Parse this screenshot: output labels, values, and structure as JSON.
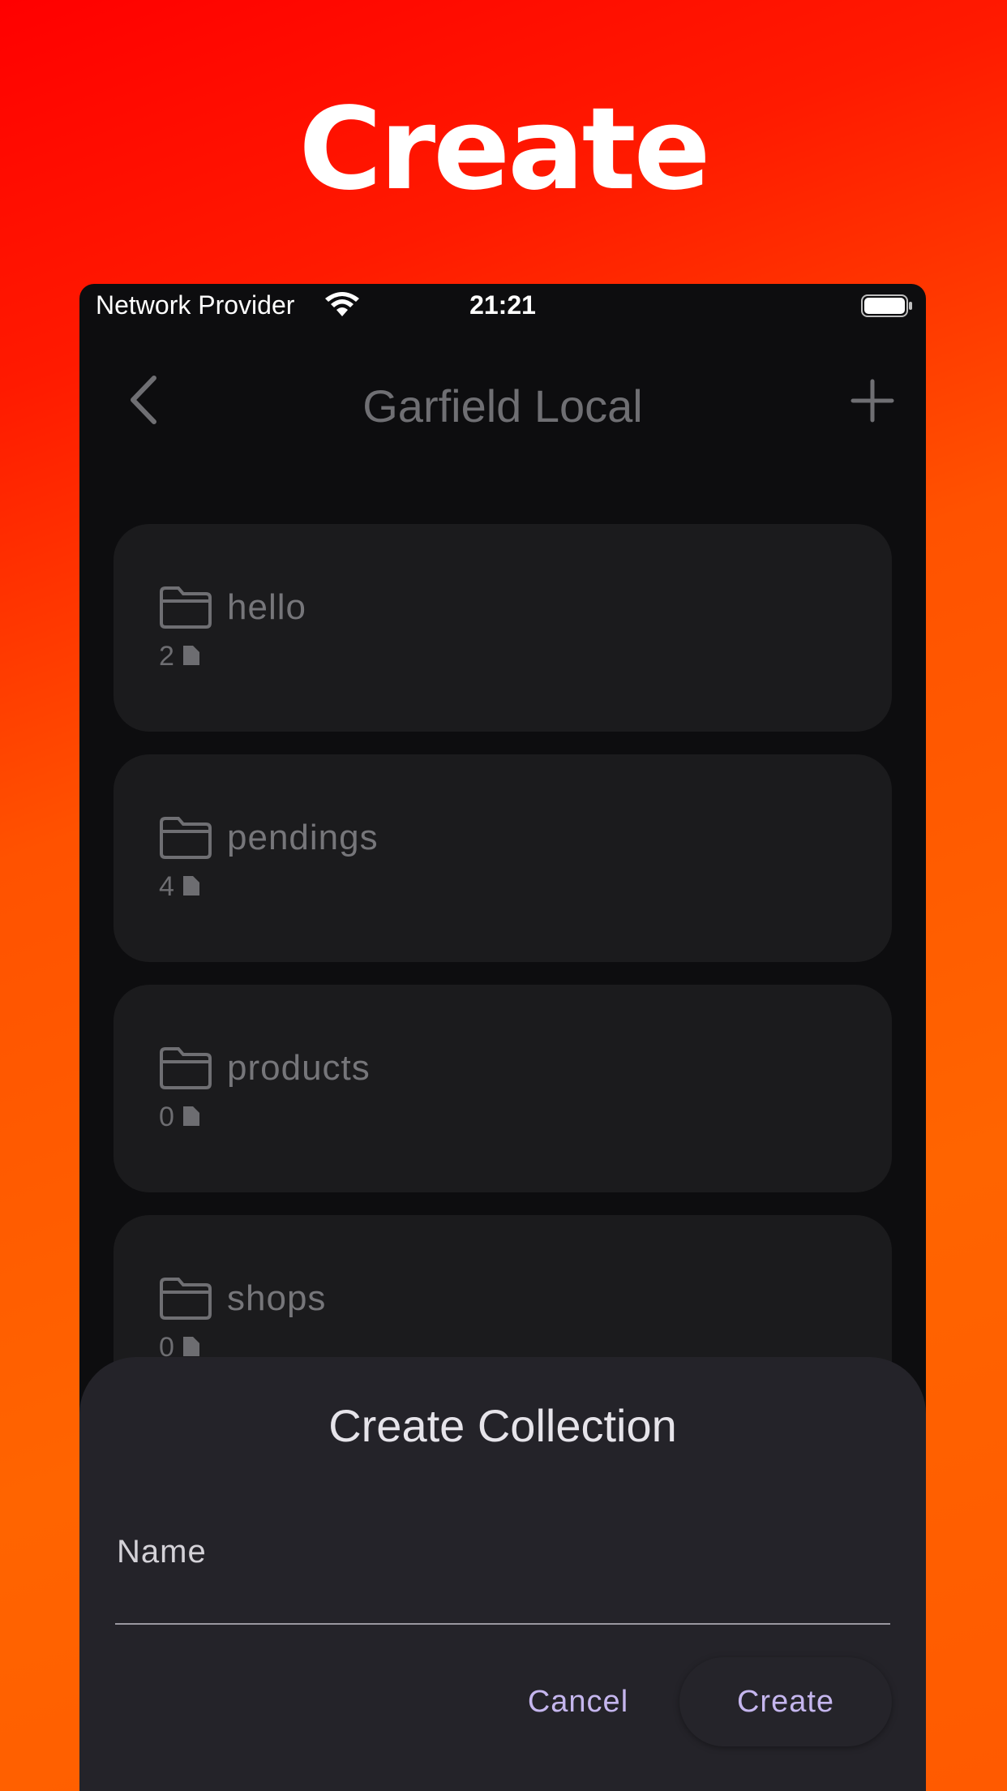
{
  "hero": {
    "title": "Create"
  },
  "status_bar": {
    "carrier": "Network Provider",
    "time": "21:21"
  },
  "nav": {
    "title": "Garfield Local",
    "back_icon": "chevron-left-icon",
    "add_icon": "plus-icon"
  },
  "collections": [
    {
      "name": "hello",
      "count": "2"
    },
    {
      "name": "pendings",
      "count": "4"
    },
    {
      "name": "products",
      "count": "0"
    },
    {
      "name": "shops",
      "count": "0"
    }
  ],
  "dialog": {
    "title": "Create Collection",
    "name_label": "Name",
    "name_value": "",
    "cancel_label": "Cancel",
    "create_label": "Create"
  },
  "colors": {
    "background_top": "#ff0000",
    "background_bottom": "#ff6400",
    "screen_bg": "#0d0d0f",
    "card_bg": "#1b1b1d",
    "sheet_bg": "#242329",
    "accent": "#c5b6ee"
  }
}
